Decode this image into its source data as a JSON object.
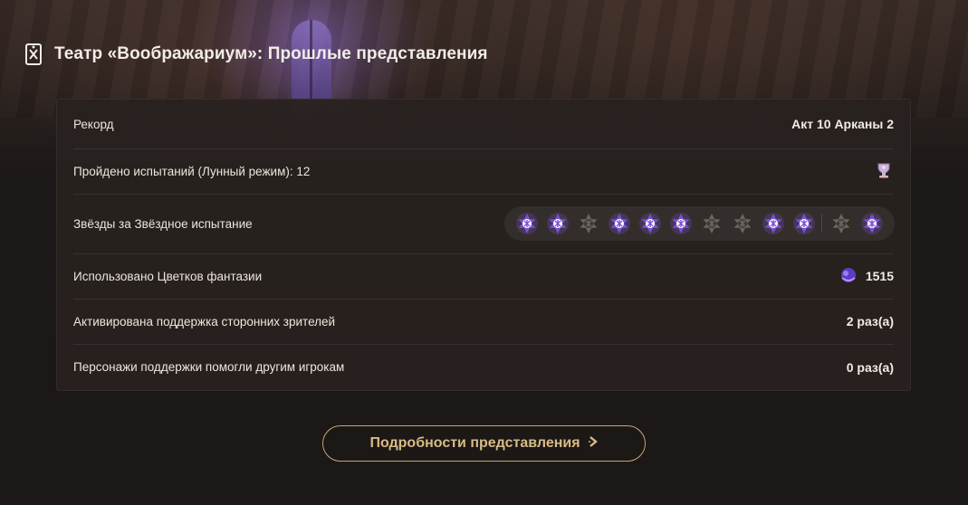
{
  "header": {
    "title": "Театр «Воображариум»: Прошлые представления",
    "icon": "theater-card-icon"
  },
  "rows": [
    {
      "label": "Рекорд",
      "value": "Акт 10 Арканы 2"
    },
    {
      "label": "Пройдено испытаний (Лунный режим): 12",
      "value": "",
      "icon": "moon-trophy-icon"
    },
    {
      "label": "Звёзды за Звёздное испытание",
      "stars": [
        true,
        true,
        false,
        true,
        true,
        true,
        false,
        false,
        true,
        true,
        false,
        true
      ]
    },
    {
      "label": "Использовано Цветков фантазии",
      "value": "1515",
      "icon": "fantasy-flower-icon"
    },
    {
      "label": "Активирована поддержка сторонних зрителей",
      "value": "2 раз(а)"
    },
    {
      "label": "Персонажи поддержки помогли другим игрокам",
      "value": "0 раз(а)"
    }
  ],
  "button": {
    "label": "Подробности представления",
    "icon": "arrow-right-icon"
  },
  "colors": {
    "accent": "#d7bb86",
    "star_lit": "#7a4fd4",
    "star_dim": "#6b6661"
  }
}
